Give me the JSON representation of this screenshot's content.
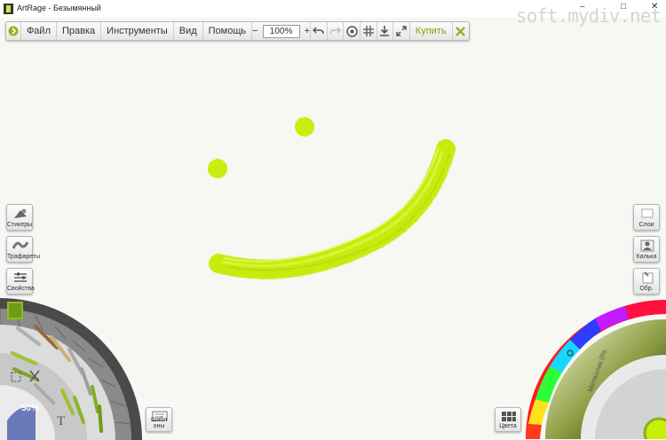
{
  "window": {
    "title": "ArtRage - Безымянный",
    "watermark": "soft.mydiv.net",
    "minimize_glyph": "–",
    "maximize_glyph": "□",
    "close_glyph": "✕"
  },
  "toolbar": {
    "menus": [
      "Файл",
      "Правка",
      "Инструменты",
      "Вид",
      "Помощь"
    ],
    "zoom_minus": "−",
    "zoom_value": "100%",
    "zoom_plus": "+",
    "buy_label": "Купить",
    "icons": [
      "panel-toggle-icon",
      "undo-icon",
      "redo-icon",
      "reference-icon",
      "grid-icon",
      "download-icon",
      "fullscreen-icon",
      "close-toolbar-icon"
    ]
  },
  "left_panel": {
    "stickers_label": "Стикеры",
    "stencils_label": "Трафареты",
    "properties_label": "Свойства",
    "tool_size": "50%",
    "text_tool_glyph": "T",
    "presets_label": "Шабл оны"
  },
  "right_panel": {
    "layers_label": "Слои",
    "tracing_label": "Калька",
    "reference_label": "Обр.",
    "colors_label": "Цвета",
    "metallic_label": "Металлик 0%"
  },
  "colors": {
    "paint": "#c8ee0a",
    "accent": "#86b01a"
  }
}
